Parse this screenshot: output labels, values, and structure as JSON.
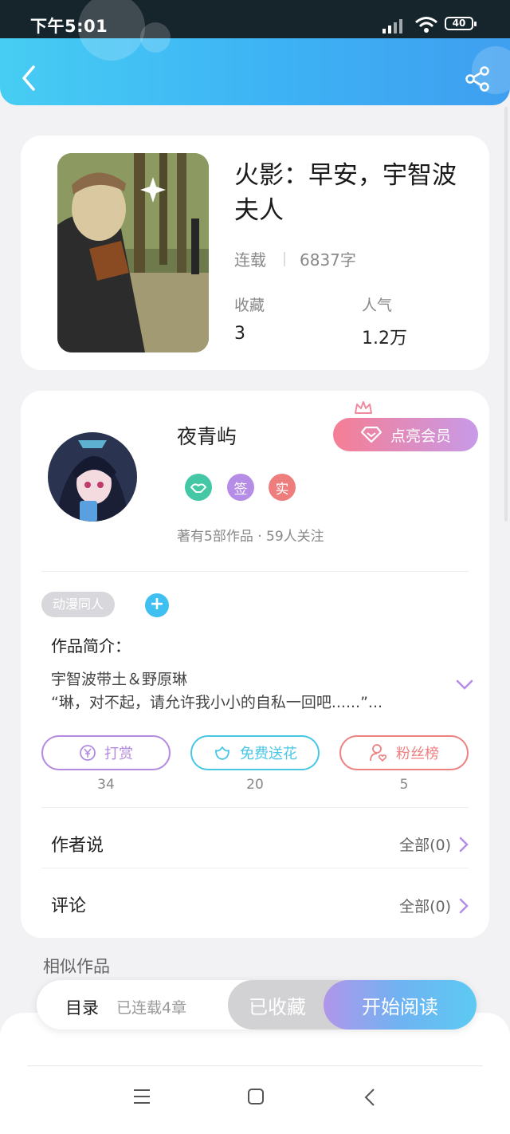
{
  "status_bar": {
    "time": "下午5:01",
    "battery": "40"
  },
  "book": {
    "title": "火影：早安，宇智波夫人",
    "status": "连载",
    "word_count": "6837字",
    "favorites_label": "收藏",
    "favorites_value": "3",
    "popularity_label": "人气",
    "popularity_value": "1.2万"
  },
  "author": {
    "name": "夜青屿",
    "vip_button": "点亮会员",
    "badges": [
      "签",
      "实"
    ],
    "info": "著有5部作品 · 59人关注"
  },
  "tag": "动漫同人",
  "intro": {
    "title": "作品简介：",
    "text": "宇智波带土＆野原琳\n“琳，对不起，请允许我小小的自私一回吧......”..."
  },
  "actions": [
    {
      "label": "打赏",
      "count": "34",
      "color": "#b38ae0"
    },
    {
      "label": "免费送花",
      "count": "20",
      "color": "#48c6e6"
    },
    {
      "label": "粉丝榜",
      "count": "5",
      "color": "#ee8080"
    }
  ],
  "author_says": {
    "title": "作者说",
    "link": "全部(0)"
  },
  "comments": {
    "title": "评论",
    "link": "全部(0)"
  },
  "similar_title": "相似作品",
  "read_bar": {
    "catalog": "目录",
    "chapters": "已连载4章",
    "favorited": "已收藏",
    "start_reading": "开始阅读"
  },
  "colors": {
    "accent": "#3db2f4",
    "vip": "#f57e94",
    "header_dark": "#16242b"
  }
}
